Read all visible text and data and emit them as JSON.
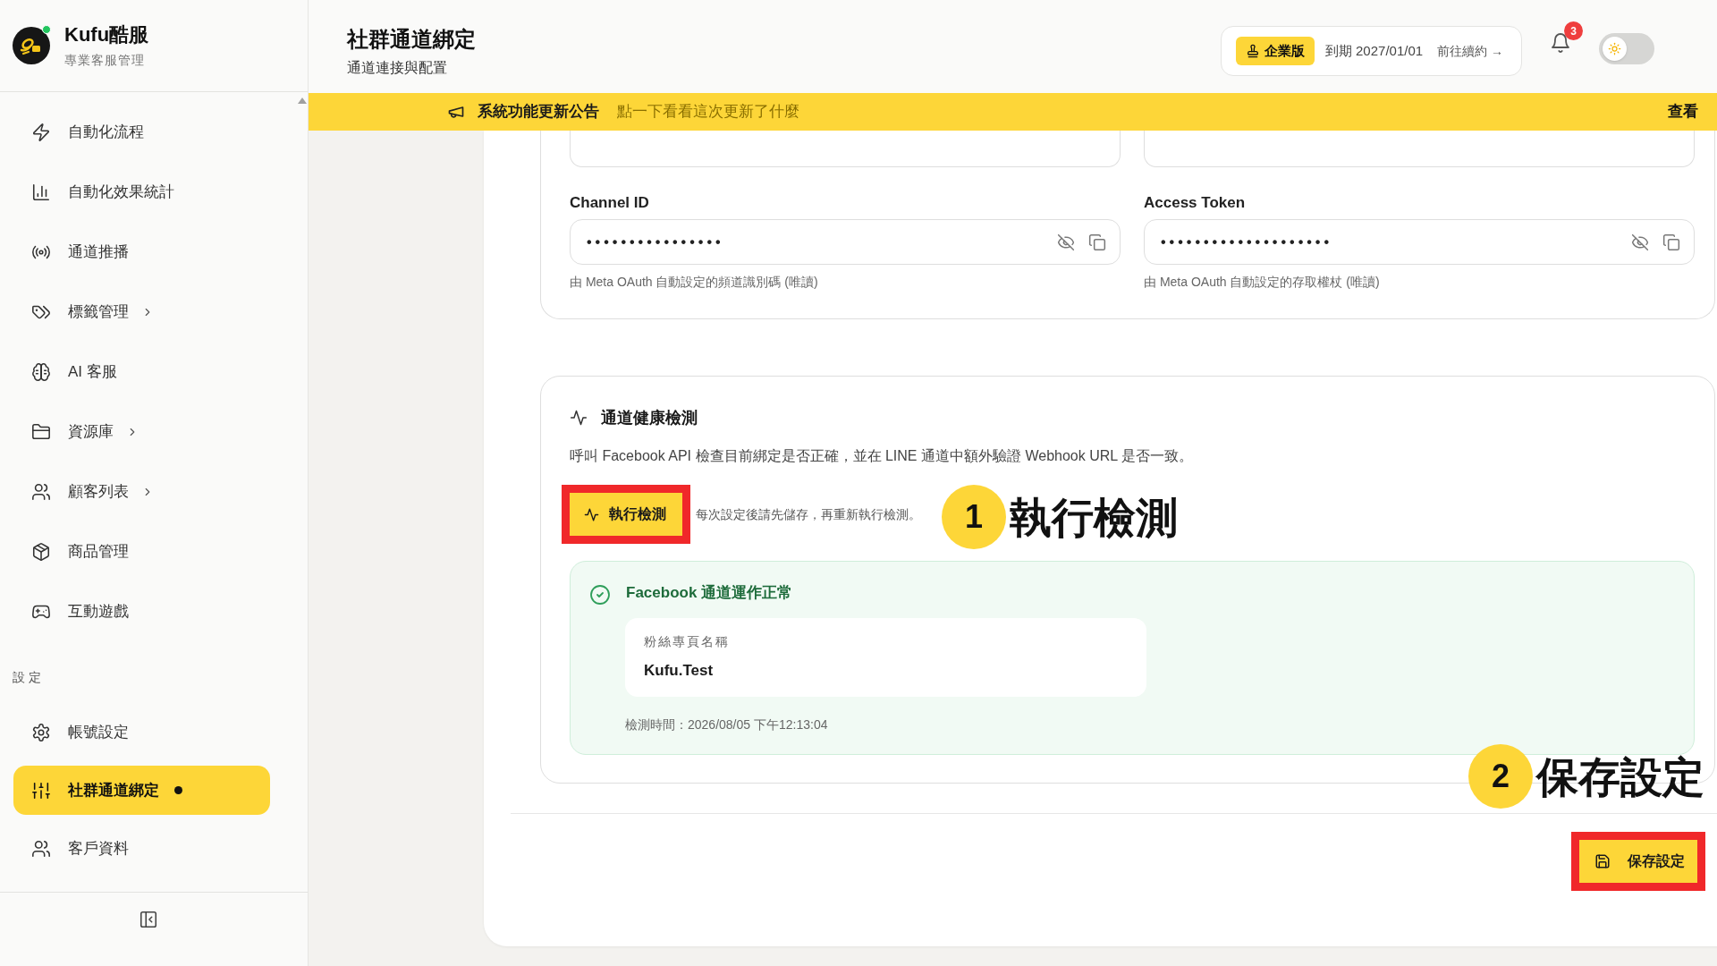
{
  "sidebar": {
    "brand": {
      "name": "Kufu酷服",
      "tagline": "專業客服管理",
      "online": true
    },
    "sections": [
      {
        "items": [
          {
            "label": "自動化流程",
            "expandable": false,
            "selected": false
          },
          {
            "label": "自動化效果統計",
            "expandable": false,
            "selected": false
          },
          {
            "label": "通道推播",
            "expandable": false,
            "selected": false
          },
          {
            "label": "標籤管理",
            "expandable": true,
            "selected": false
          },
          {
            "label": "AI 客服",
            "expandable": false,
            "selected": false
          },
          {
            "label": "資源庫",
            "expandable": true,
            "selected": false
          },
          {
            "label": "顧客列表",
            "expandable": true,
            "selected": false
          },
          {
            "label": "商品管理",
            "expandable": false,
            "selected": false
          },
          {
            "label": "互動遊戲",
            "expandable": false,
            "selected": false
          }
        ]
      },
      {
        "title": "設定",
        "items": [
          {
            "label": "帳號設定",
            "expandable": false,
            "selected": false
          },
          {
            "label": "社群通道綁定",
            "expandable": false,
            "selected": true
          },
          {
            "label": "客戶資料",
            "expandable": false,
            "selected": false
          }
        ]
      }
    ]
  },
  "header": {
    "title": "社群通道綁定",
    "subtitle": "通道連接與配置",
    "plan": {
      "badge": "企業版",
      "expiry": "到期 2027/01/01",
      "renew": "前往續約 →"
    },
    "notifications": {
      "count": "3"
    },
    "theme_toggle": {
      "on": false
    }
  },
  "banner": {
    "title": "系統功能更新公告",
    "message": "點一下看看這次更新了什麼",
    "action": "查看"
  },
  "credentials": {
    "fields": [
      {
        "label": "Channel ID",
        "value": "••••••••••••••••",
        "helper": "由 Meta OAuth 自動設定的頻道識別碼 (唯讀)"
      },
      {
        "label": "Access Token",
        "value": "••••••••••••••••••••",
        "helper": "由 Meta OAuth 自動設定的存取權杖 (唯讀)"
      }
    ]
  },
  "health_check": {
    "title": "通道健康檢測",
    "description": "呼叫 Facebook API 檢查目前綁定是否正確，並在 LINE 通道中額外驗證 Webhook URL 是否一致。",
    "run_button": {
      "label": "執行檢測",
      "highlighted": true
    },
    "note": "每次設定後請先儲存，再重新執行檢測。",
    "result": {
      "kind": "success",
      "title": "Facebook 通道運作正常",
      "fields": [
        {
          "label": "粉絲專頁名稱",
          "value": "Kufu.Test"
        }
      ],
      "checked_at": "檢測時間：2026/08/05 下午12:13:04"
    }
  },
  "save_button": {
    "label": "保存設定",
    "highlighted": true
  },
  "annotations": [
    {
      "number": "1",
      "text": "執行檢測"
    },
    {
      "number": "2",
      "text": "保存設定"
    }
  ]
}
